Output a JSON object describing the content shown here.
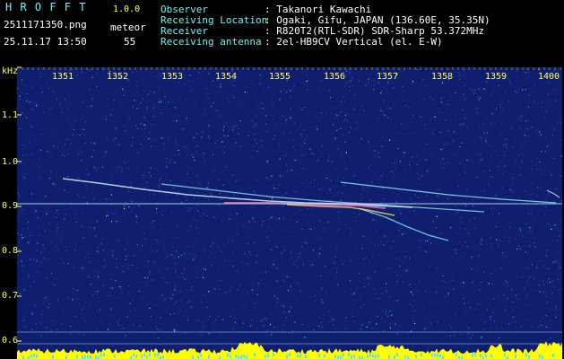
{
  "header": {
    "app_name": "H R O F F T",
    "version": "1.0.0",
    "filename": "2511171350.png",
    "mode": "meteor",
    "datetime": "25.11.17 13:50",
    "count": "55",
    "fields": [
      {
        "label": "Observer",
        "value": ": Takanori Kawachi"
      },
      {
        "label": "Receiving Location",
        "value": ": Ogaki, Gifu, JAPAN (136.60E, 35.35N)"
      },
      {
        "label": "Receiver",
        "value": ": R820T2(RTL-SDR) SDR-Sharp 53.372MHz"
      },
      {
        "label": "Receiving antenna",
        "value": ": 2el-HB9CV Vertical (el. E-W)"
      }
    ]
  },
  "plot": {
    "y_unit": "kHz",
    "y_ticks": [
      "1.1",
      "1.0",
      "0.9",
      "0.8",
      "0.7",
      "0.6"
    ],
    "x_ticks": [
      "1351",
      "1352",
      "1353",
      "1354",
      "1355",
      "1356",
      "1357",
      "1358",
      "1359",
      "1400"
    ]
  },
  "colors": {
    "background": "#000000",
    "spectrogram_bg": "#101e6e",
    "header_label": "#6ef2f2",
    "header_value": "#ffffff",
    "axis_text": "#ffff5a",
    "level_bar": "#ffff00"
  }
}
